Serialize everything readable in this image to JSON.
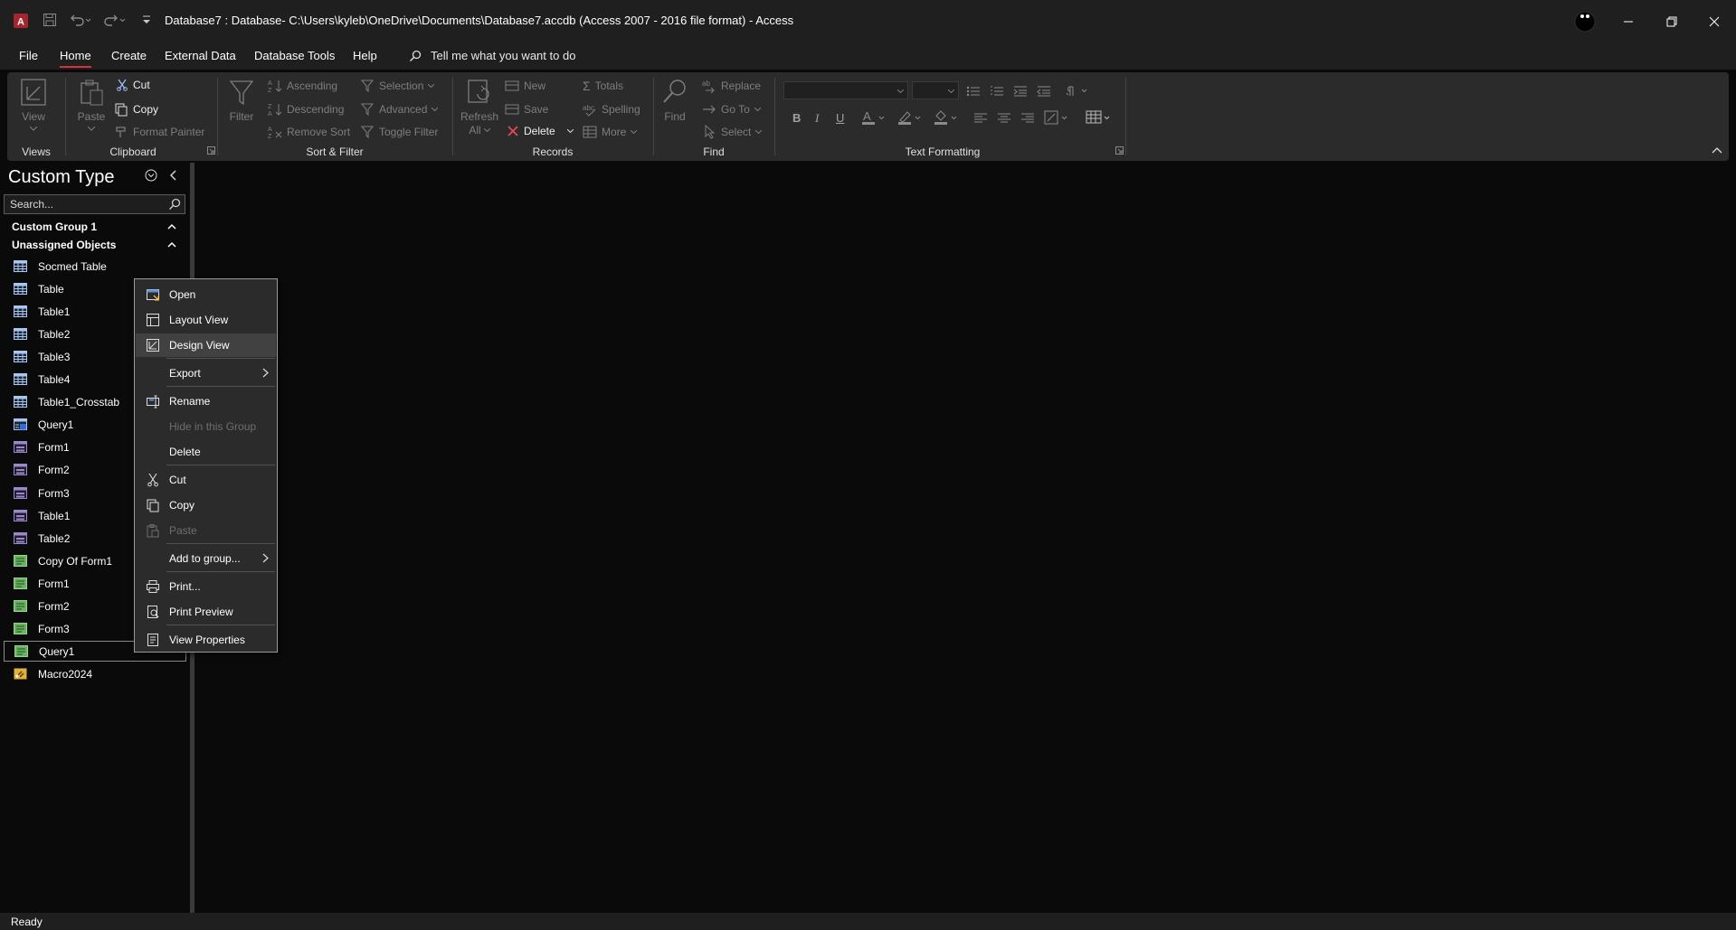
{
  "window": {
    "title": "Database7 : Database- C:\\Users\\kyleb\\OneDrive\\Documents\\Database7.accdb (Access 2007 - 2016 file format)  -  Access",
    "app_logo_letter": "A",
    "quick_access": [
      "save-icon",
      "undo-icon",
      "redo-icon",
      "customize-icon"
    ]
  },
  "menu": {
    "tabs": [
      {
        "label": "File"
      },
      {
        "label": "Home",
        "active": true
      },
      {
        "label": "Create"
      },
      {
        "label": "External Data"
      },
      {
        "label": "Database Tools"
      },
      {
        "label": "Help"
      }
    ],
    "tell_me": "Tell me what you want to do"
  },
  "ribbon": {
    "groups": {
      "views": "Views",
      "clipboard": "Clipboard",
      "sort_filter": "Sort & Filter",
      "records": "Records",
      "find": "Find",
      "text_formatting": "Text Formatting"
    },
    "views": {
      "view": "View"
    },
    "clipboard": {
      "paste": "Paste",
      "cut": "Cut",
      "copy": "Copy",
      "format_painter": "Format Painter"
    },
    "sort_filter": {
      "filter": "Filter",
      "ascending": "Ascending",
      "descending": "Descending",
      "remove_sort": "Remove Sort",
      "selection": "Selection",
      "advanced": "Advanced",
      "toggle_filter": "Toggle Filter"
    },
    "records": {
      "refresh": "Refresh",
      "refresh_all": "All",
      "new": "New",
      "save": "Save",
      "delete": "Delete",
      "totals": "Totals",
      "spelling": "Spelling",
      "more": "More"
    },
    "find": {
      "find": "Find",
      "replace": "Replace",
      "go_to": "Go To",
      "select": "Select"
    },
    "text_formatting": {
      "bold": "B",
      "italic": "I",
      "underline": "U"
    }
  },
  "nav": {
    "title": "Custom Type",
    "search_placeholder": "Search...",
    "groups": [
      "Custom Group 1",
      "Unassigned Objects"
    ],
    "items": [
      {
        "label": "Socmed Table",
        "type": "table"
      },
      {
        "label": "Table",
        "type": "table"
      },
      {
        "label": "Table1",
        "type": "table"
      },
      {
        "label": "Table2",
        "type": "table"
      },
      {
        "label": "Table3",
        "type": "table"
      },
      {
        "label": "Table4",
        "type": "table"
      },
      {
        "label": "Table1_Crosstab",
        "type": "table"
      },
      {
        "label": "Query1",
        "type": "query"
      },
      {
        "label": "Form1",
        "type": "form"
      },
      {
        "label": "Form2",
        "type": "form"
      },
      {
        "label": "Form3",
        "type": "form"
      },
      {
        "label": "Table1",
        "type": "form"
      },
      {
        "label": "Table2",
        "type": "form"
      },
      {
        "label": "Copy Of Form1",
        "type": "report"
      },
      {
        "label": "Form1",
        "type": "report"
      },
      {
        "label": "Form2",
        "type": "report"
      },
      {
        "label": "Form3",
        "type": "report"
      },
      {
        "label": "Query1",
        "type": "report",
        "selected": true
      },
      {
        "label": "Macro2024",
        "type": "macro"
      }
    ]
  },
  "context_menu": {
    "items": [
      {
        "label": "Open",
        "icon": "open-icon"
      },
      {
        "label": "Layout View",
        "icon": "layout-view-icon"
      },
      {
        "label": "Design View",
        "icon": "design-view-icon",
        "highlighted": true
      },
      {
        "label": "Export",
        "submenu": true
      },
      {
        "label": "Rename",
        "icon": "rename-icon"
      },
      {
        "label": "Hide in this Group",
        "disabled": true
      },
      {
        "label": "Delete"
      },
      {
        "label": "Cut",
        "icon": "cut-icon"
      },
      {
        "label": "Copy",
        "icon": "copy-icon"
      },
      {
        "label": "Paste",
        "icon": "paste-icon",
        "disabled": true
      },
      {
        "label": "Add to group...",
        "submenu": true
      },
      {
        "label": "Print...",
        "icon": "print-icon"
      },
      {
        "label": "Print Preview",
        "icon": "print-preview-icon"
      },
      {
        "label": "View Properties",
        "icon": "properties-icon"
      }
    ]
  },
  "status": {
    "text": "Ready"
  },
  "colors": {
    "accent": "#d13438",
    "background": "#0a0a0a",
    "chrome": "#1f1f1f",
    "ribbon": "#2b2b2b",
    "table_icon": "#a9c6ef",
    "form_icon": "#9c87c9",
    "report_icon": "#67b35f",
    "macro_icon": "#e2b13c"
  }
}
